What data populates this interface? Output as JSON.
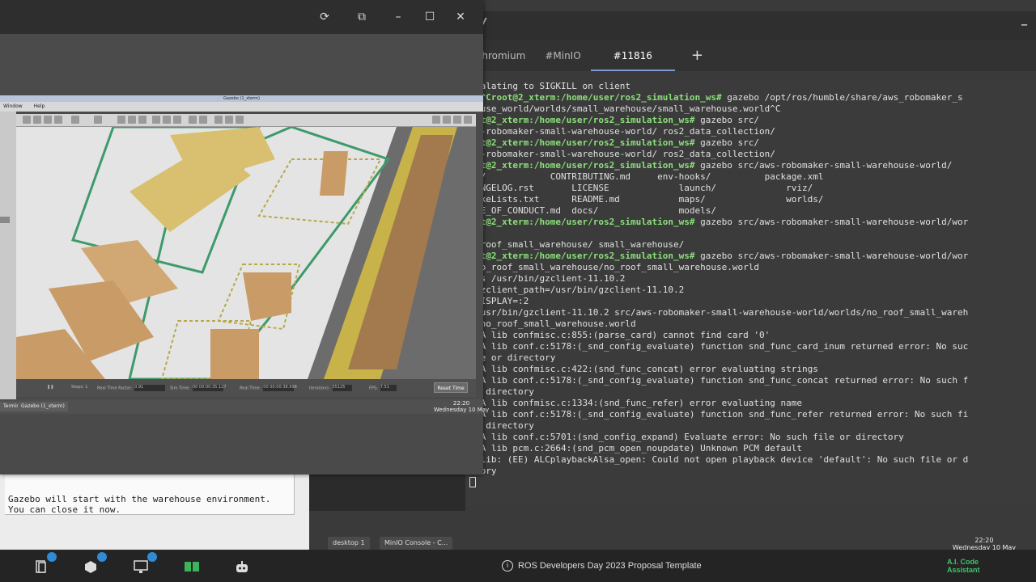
{
  "terminal": {
    "tabs": [
      {
        "label": "Chromium"
      },
      {
        "label": "#MinIO"
      },
      {
        "label": "#11816"
      }
    ],
    "new_tab": "+",
    "lines": [
      {
        "prompt": "",
        "text": "calating to SIGKILL on client"
      },
      {
        "prompt": "C^Croot@2_xterm:/home/user/ros2_simulation_ws#",
        "text": " gazebo /opt/ros/humble/share/aws_robomaker_s"
      },
      {
        "prompt": "",
        "text": "ouse_world/worlds/small_warehouse/small_warehouse.world^C"
      },
      {
        "prompt": "ot@2_xterm:/home/user/ros2_simulation_ws#",
        "text": " gazebo src/"
      },
      {
        "prompt": "",
        "text": "s-robomaker-small-warehouse-world/ ros2_data_collection/"
      },
      {
        "prompt": "ot@2_xterm:/home/user/ros2_simulation_ws#",
        "text": " gazebo src/"
      },
      {
        "prompt": "",
        "text": "s-robomaker-small-warehouse-world/ ros2_data_collection/"
      },
      {
        "prompt": "ot@2_xterm:/home/user/ros2_simulation_ws#",
        "text": " gazebo src/aws-robomaker-small-warehouse-world/"
      },
      {
        "prompt": "",
        "text": "t/            CONTRIBUTING.md     env-hooks/          package.xml"
      },
      {
        "prompt": "",
        "text": "ANGELOG.rst       LICENSE             launch/             rviz/"
      },
      {
        "prompt": "",
        "text": "akeLists.txt      README.md           maps/               worlds/"
      },
      {
        "prompt": "",
        "text": "DE_OF_CONDUCT.md  docs/               models/"
      },
      {
        "prompt": "ot@2_xterm:/home/user/ros2_simulation_ws#",
        "text": " gazebo src/aws-robomaker-small-warehouse-world/wor"
      },
      {
        "prompt": "",
        "text": ""
      },
      {
        "prompt": "",
        "text": "_roof_small_warehouse/ small_warehouse/"
      },
      {
        "prompt": "ot@2_xterm:/home/user/ros2_simulation_ws#",
        "text": " gazebo src/aws-robomaker-small-warehouse-world/wor"
      },
      {
        "prompt": "",
        "text": "no_roof_small_warehouse/no_roof_small_warehouse.world"
      },
      {
        "prompt": "",
        "text": "ls /usr/bin/gzclient-11.10.2"
      },
      {
        "prompt": "",
        "text": "gzclient_path=/usr/bin/gzclient-11.10.2"
      },
      {
        "prompt": "",
        "text": "DISPLAY=:2"
      },
      {
        "prompt": "",
        "text": "/usr/bin/gzclient-11.10.2 src/aws-robomaker-small-warehouse-world/worlds/no_roof_small_wareh"
      },
      {
        "prompt": "",
        "text": "/no_roof_small_warehouse.world"
      },
      {
        "prompt": "",
        "text": "SA lib confmisc.c:855:(parse_card) cannot find card '0'"
      },
      {
        "prompt": "",
        "text": "SA lib conf.c:5178:(_snd_config_evaluate) function snd_func_card_inum returned error: No suc"
      },
      {
        "prompt": "",
        "text": "le or directory"
      },
      {
        "prompt": "",
        "text": "SA lib confmisc.c:422:(snd_func_concat) error evaluating strings"
      },
      {
        "prompt": "",
        "text": "SA lib conf.c:5178:(_snd_config_evaluate) function snd_func_concat returned error: No such f"
      },
      {
        "prompt": "",
        "text": "r directory"
      },
      {
        "prompt": "",
        "text": "SA lib confmisc.c:1334:(snd_func_refer) error evaluating name"
      },
      {
        "prompt": "",
        "text": "SA lib conf.c:5178:(_snd_config_evaluate) function snd_func_refer returned error: No such fi"
      },
      {
        "prompt": "",
        "text": "r directory"
      },
      {
        "prompt": "",
        "text": "SA lib conf.c:5701:(snd_config_expand) Evaluate error: No such file or directory"
      },
      {
        "prompt": "",
        "text": "SA lib pcm.c:2664:(snd_pcm_open_noupdate) Unknown PCM default"
      },
      {
        "prompt": "",
        "text": " lib: (EE) ALCplaybackAlsa_open: Could not open playback device 'default': No such file or d"
      },
      {
        "prompt": "",
        "text": "tory"
      }
    ]
  },
  "desktop2_taskbar": {
    "items": [
      "desktop 1",
      "MinIO Console - C..."
    ],
    "clock_time": "22:20",
    "clock_date": "Wednesday 10 May"
  },
  "gazebo": {
    "title": "Gazebo (1_xterm)",
    "menu": [
      "Window",
      "Help"
    ],
    "stats": {
      "steps_label": "Steps: 1",
      "rtf_label": "Real Time Factor:",
      "rtf_value": "0.91",
      "sim_time_label": "Sim Time:",
      "sim_time_value": "00 00:00:35.127",
      "real_time_label": "Real Time:",
      "real_time_value": "00 00:00:38.998",
      "iterations_label": "Iterations:",
      "iterations_value": "35125",
      "fps_label": "FPS:",
      "fps_value": "7.51"
    },
    "reset_label": "Reset Time",
    "taskbar": [
      "Terminal",
      "Gazebo (1_xterm)"
    ],
    "clock_time": "22:20",
    "clock_date": "Wednesday 10 May"
  },
  "doc": {
    "line1": "Gazebo will start with the warehouse environment.",
    "line2": "You can close it now."
  },
  "dock": {
    "title": "ROS Developers Day 2023 Proposal Template",
    "assistant_line1": "A.I. Code",
    "assistant_line2": "Assistant",
    "badges": [
      "1",
      "1",
      "1"
    ]
  },
  "colors": {
    "prompt": "#8be07a",
    "badge": "#2f8bd6",
    "assistant": "#43c36a"
  }
}
